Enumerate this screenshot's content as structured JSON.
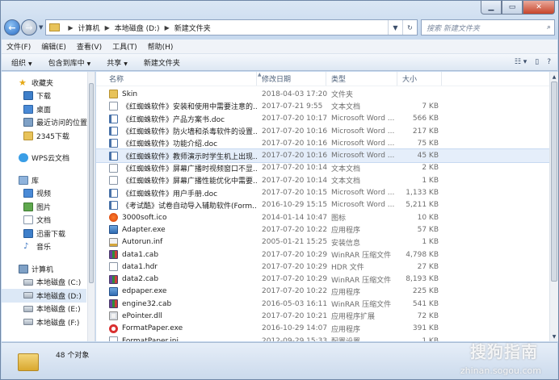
{
  "address": {
    "crumbs": [
      "计算机",
      "本地磁盘 (D:)",
      "新建文件夹"
    ],
    "search_placeholder": "搜索 新建文件夹"
  },
  "menu": [
    "文件(F)",
    "编辑(E)",
    "查看(V)",
    "工具(T)",
    "帮助(H)"
  ],
  "toolbar": {
    "organize": "组织",
    "include": "包含到库中",
    "share": "共享",
    "new_folder": "新建文件夹"
  },
  "nav": {
    "favorites": "收藏夹",
    "fav_items": [
      "下载",
      "桌面",
      "最近访问的位置",
      "2345下载"
    ],
    "wps": "WPS云文档",
    "library": "库",
    "lib_items": [
      "视频",
      "图片",
      "文档",
      "迅雷下载",
      "音乐"
    ],
    "computer": "计算机",
    "drives": [
      "本地磁盘 (C:)",
      "本地磁盘 (D:)",
      "本地磁盘 (E:)",
      "本地磁盘 (F:)"
    ]
  },
  "columns": {
    "name": "名称",
    "date": "修改日期",
    "type": "类型",
    "size": "大小"
  },
  "files": [
    {
      "name": "Skin",
      "date": "2018-04-03 17:20",
      "type": "文件夹",
      "size": "",
      "icon": "folder"
    },
    {
      "name": "《红蜘蛛软件》安装和使用中需要注意的...",
      "date": "2017-07-21 9:55",
      "type": "文本文档",
      "size": "7 KB",
      "icon": "txt"
    },
    {
      "name": "《红蜘蛛软件》产品方案书.doc",
      "date": "2017-07-20 10:17",
      "type": "Microsoft Word ...",
      "size": "566 KB",
      "icon": "doc"
    },
    {
      "name": "《红蜘蛛软件》防火墙和杀毒软件的设置...",
      "date": "2017-07-20 10:16",
      "type": "Microsoft Word ...",
      "size": "217 KB",
      "icon": "doc"
    },
    {
      "name": "《红蜘蛛软件》功能介绍.doc",
      "date": "2017-07-20 10:16",
      "type": "Microsoft Word ...",
      "size": "75 KB",
      "icon": "doc"
    },
    {
      "name": "《红蜘蛛软件》教师演示时学生机上出现...",
      "date": "2017-07-20 10:16",
      "type": "Microsoft Word ...",
      "size": "45 KB",
      "icon": "doc"
    },
    {
      "name": "《红蜘蛛软件》屏幕广播时视频窗口不显...",
      "date": "2017-07-20 10:14",
      "type": "文本文档",
      "size": "2 KB",
      "icon": "txt"
    },
    {
      "name": "《红蜘蛛软件》屏幕广播性能优化中需要...",
      "date": "2017-07-20 10:14",
      "type": "文本文档",
      "size": "1 KB",
      "icon": "txt"
    },
    {
      "name": "《红蜘蛛软件》用户手册.doc",
      "date": "2017-07-20 10:15",
      "type": "Microsoft Word ...",
      "size": "1,133 KB",
      "icon": "doc"
    },
    {
      "name": "《考试酷》试卷自动导入辅助软件(Form...",
      "date": "2016-10-29 15:15",
      "type": "Microsoft Word ...",
      "size": "5,211 KB",
      "icon": "doc"
    },
    {
      "name": "3000soft.ico",
      "date": "2014-01-14 10:47",
      "type": "图标",
      "size": "10 KB",
      "icon": "ico"
    },
    {
      "name": "Adapter.exe",
      "date": "2017-07-20 10:22",
      "type": "应用程序",
      "size": "57 KB",
      "icon": "exe"
    },
    {
      "name": "Autorun.inf",
      "date": "2005-01-21 15:25",
      "type": "安装信息",
      "size": "1 KB",
      "icon": "inf"
    },
    {
      "name": "data1.cab",
      "date": "2017-07-20 10:29",
      "type": "WinRAR 压缩文件",
      "size": "4,798 KB",
      "icon": "cab"
    },
    {
      "name": "data1.hdr",
      "date": "2017-07-20 10:29",
      "type": "HDR 文件",
      "size": "27 KB",
      "icon": "hdr"
    },
    {
      "name": "data2.cab",
      "date": "2017-07-20 10:29",
      "type": "WinRAR 压缩文件",
      "size": "8,193 KB",
      "icon": "cab"
    },
    {
      "name": "edpaper.exe",
      "date": "2017-07-20 10:22",
      "type": "应用程序",
      "size": "225 KB",
      "icon": "exe"
    },
    {
      "name": "engine32.cab",
      "date": "2016-05-03 16:11",
      "type": "WinRAR 压缩文件",
      "size": "541 KB",
      "icon": "cab"
    },
    {
      "name": "ePointer.dll",
      "date": "2017-07-20 10:21",
      "type": "应用程序扩展",
      "size": "72 KB",
      "icon": "dll"
    },
    {
      "name": "FormatPaper.exe",
      "date": "2016-10-29 14:07",
      "type": "应用程序",
      "size": "391 KB",
      "icon": "red"
    },
    {
      "name": "FormatPaper.ini",
      "date": "2012-09-29 15:33",
      "type": "配置设置",
      "size": "1 KB",
      "icon": "ini"
    }
  ],
  "status": {
    "count": "48 个对象"
  },
  "watermark": {
    "brand": "搜狗指南",
    "url": "zhinan.sogou.com"
  }
}
